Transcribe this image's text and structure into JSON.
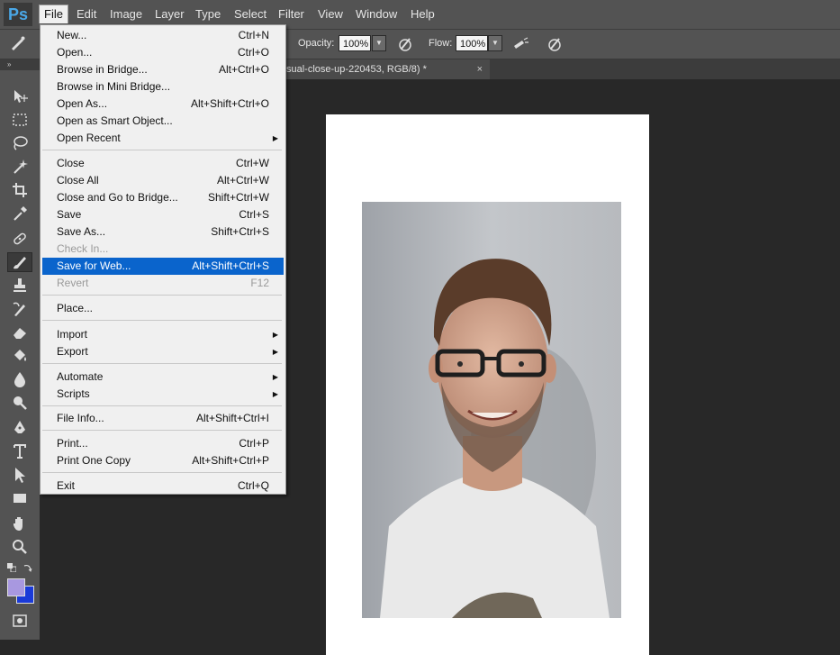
{
  "app": {
    "logo": "Ps"
  },
  "menubar": {
    "items": [
      "File",
      "Edit",
      "Image",
      "Layer",
      "Type",
      "Select",
      "Filter",
      "View",
      "Window",
      "Help"
    ]
  },
  "options": {
    "opacity_label": "Opacity:",
    "opacity_value": "100%",
    "flow_label": "Flow:",
    "flow_value": "100%"
  },
  "document_tab": {
    "title": "sual-close-up-220453, RGB/8) *",
    "close": "×"
  },
  "toolbar": {
    "header": "»"
  },
  "file_menu": {
    "new": {
      "label": "New...",
      "shortcut": "Ctrl+N"
    },
    "open": {
      "label": "Open...",
      "shortcut": "Ctrl+O"
    },
    "browse_bridge": {
      "label": "Browse in Bridge...",
      "shortcut": "Alt+Ctrl+O"
    },
    "browse_mini": {
      "label": "Browse in Mini Bridge...",
      "shortcut": ""
    },
    "open_as": {
      "label": "Open As...",
      "shortcut": "Alt+Shift+Ctrl+O"
    },
    "open_smart": {
      "label": "Open as Smart Object...",
      "shortcut": ""
    },
    "open_recent": {
      "label": "Open Recent",
      "shortcut": ""
    },
    "close": {
      "label": "Close",
      "shortcut": "Ctrl+W"
    },
    "close_all": {
      "label": "Close All",
      "shortcut": "Alt+Ctrl+W"
    },
    "close_bridge": {
      "label": "Close and Go to Bridge...",
      "shortcut": "Shift+Ctrl+W"
    },
    "save": {
      "label": "Save",
      "shortcut": "Ctrl+S"
    },
    "save_as": {
      "label": "Save As...",
      "shortcut": "Shift+Ctrl+S"
    },
    "check_in": {
      "label": "Check In...",
      "shortcut": ""
    },
    "save_web": {
      "label": "Save for Web...",
      "shortcut": "Alt+Shift+Ctrl+S"
    },
    "revert": {
      "label": "Revert",
      "shortcut": "F12"
    },
    "place": {
      "label": "Place...",
      "shortcut": ""
    },
    "import": {
      "label": "Import",
      "shortcut": ""
    },
    "export": {
      "label": "Export",
      "shortcut": ""
    },
    "automate": {
      "label": "Automate",
      "shortcut": ""
    },
    "scripts": {
      "label": "Scripts",
      "shortcut": ""
    },
    "file_info": {
      "label": "File Info...",
      "shortcut": "Alt+Shift+Ctrl+I"
    },
    "print": {
      "label": "Print...",
      "shortcut": "Ctrl+P"
    },
    "print_one": {
      "label": "Print One Copy",
      "shortcut": "Alt+Shift+Ctrl+P"
    },
    "exit": {
      "label": "Exit",
      "shortcut": "Ctrl+Q"
    },
    "submenu_arrow": "▶"
  },
  "colors": {
    "accent_highlight": "#0a64cc",
    "foreground_swatch": "#a898e0",
    "background_swatch": "#1a3ad8"
  }
}
